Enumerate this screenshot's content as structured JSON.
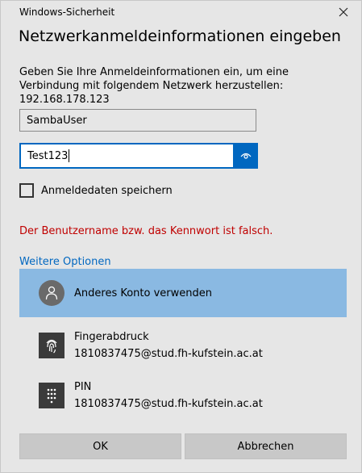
{
  "window": {
    "title": "Windows-Sicherheit"
  },
  "heading": "Netzwerkanmeldeinformationen eingeben",
  "description": "Geben Sie Ihre Anmeldeinformationen ein, um eine Verbindung mit folgendem Netzwerk herzustellen: 192.168.178.123",
  "username": {
    "value": "SambaUser"
  },
  "password": {
    "value": "Test123"
  },
  "remember": {
    "label": "Anmeldedaten speichern",
    "checked": false
  },
  "error": "Der Benutzername bzw. das Kennwort ist falsch.",
  "more_options": "Weitere Optionen",
  "options": [
    {
      "title": "Anderes Konto verwenden",
      "subtitle": "",
      "icon": "user-icon",
      "selected": true
    },
    {
      "title": "Fingerabdruck",
      "subtitle": "1810837475@stud.fh-kufstein.ac.at",
      "icon": "fingerprint-icon",
      "selected": false
    },
    {
      "title": "PIN",
      "subtitle": "1810837475@stud.fh-kufstein.ac.at",
      "icon": "pin-keypad-icon",
      "selected": false
    }
  ],
  "buttons": {
    "ok": "OK",
    "cancel": "Abbrechen"
  },
  "colors": {
    "accent": "#0067c0",
    "selected": "#8ab9e2",
    "error": "#c00000",
    "background": "#e6e6e6"
  }
}
